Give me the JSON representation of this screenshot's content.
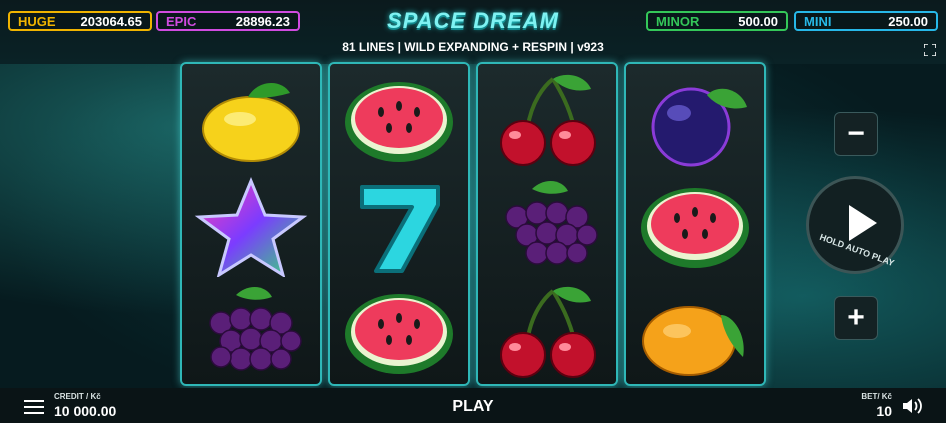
{
  "jackpots": [
    {
      "name": "HUGE",
      "value": "203064.65",
      "color": "#f0b400"
    },
    {
      "name": "EPIC",
      "value": "28896.23",
      "color": "#d04be0"
    },
    {
      "name": "MINOR",
      "value": "500.00",
      "color": "#34c759"
    },
    {
      "name": "MINI",
      "value": "250.00",
      "color": "#27b8e8"
    }
  ],
  "game": {
    "title": "SPACE DREAM",
    "subtitle": "81 LINES  |  WILD EXPANDING + RESPIN  |  v923"
  },
  "reels": [
    [
      "lemon-icon",
      "star-icon",
      "grapes-icon"
    ],
    [
      "watermelon-icon",
      "seven-icon",
      "watermelon-icon"
    ],
    [
      "cherries-icon",
      "grapes-icon",
      "cherries-icon"
    ],
    [
      "plum-icon",
      "watermelon-icon",
      "orange-icon"
    ]
  ],
  "controls": {
    "minus": "−",
    "plus": "+",
    "hold_label": "HOLD AUTO PLAY"
  },
  "bottom": {
    "credit_label": "CREDIT / Kč",
    "credit_value": "10 000.00",
    "play_label": "PLAY",
    "bet_label": "BET/ Kč",
    "bet_value": "10"
  }
}
